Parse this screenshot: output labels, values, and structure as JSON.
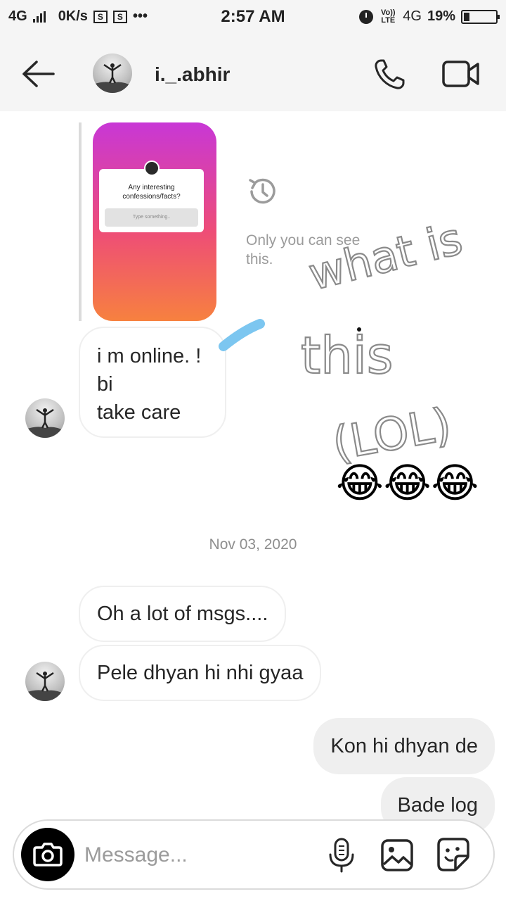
{
  "status_bar": {
    "network": "4G",
    "speed": "0K/s",
    "sim1": "S",
    "sim2": "S",
    "more": "•••",
    "time": "2:57 AM",
    "volte": "Vo)) LTE",
    "network_right": "4G",
    "battery": "19%",
    "battery_level_pct": 19
  },
  "header": {
    "username": "i._.abhir",
    "back_icon": "arrow-left-icon",
    "call_icon": "phone-icon",
    "video_icon": "video-camera-icon"
  },
  "story_reply": {
    "question": "Any interesting confessions/facts?",
    "input_placeholder": "Type something..",
    "note": "Only you can see this.",
    "note_icon": "history-icon",
    "gradient_colors": [
      "#c837d6",
      "#ee4d77",
      "#f7813f"
    ]
  },
  "messages_incoming_1": [
    "i m online. !",
    "bi",
    "take care"
  ],
  "annotation": {
    "handwriting": [
      "what is",
      "this",
      "(LOL)"
    ],
    "emojis": "😂😂😂"
  },
  "date_separator": "Nov 03, 2020",
  "messages": [
    {
      "direction": "in",
      "text": "Oh a lot of msgs...."
    },
    {
      "direction": "in",
      "text": "Pele dhyan hi nhi gyaa"
    },
    {
      "direction": "out",
      "text": "Kon hi dhyan de"
    },
    {
      "direction": "out",
      "text": "Bade log"
    }
  ],
  "composer": {
    "placeholder": "Message...",
    "camera_icon": "camera-icon",
    "mic_icon": "microphone-icon",
    "gallery_icon": "image-icon",
    "sticker_icon": "sticker-icon"
  }
}
